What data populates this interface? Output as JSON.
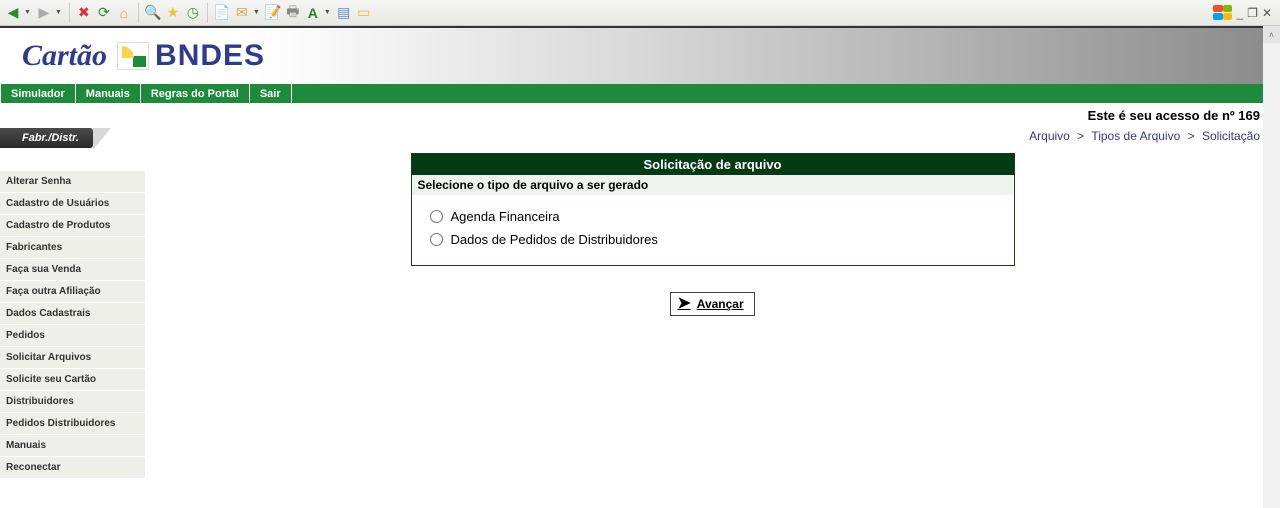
{
  "toolbar": {
    "icons": [
      "back",
      "forward",
      "stop",
      "refresh",
      "home",
      "search",
      "favorites",
      "history",
      "copy",
      "mail",
      "save",
      "print",
      "font-size",
      "edit",
      "note"
    ]
  },
  "window": {
    "minimize": "_",
    "restore": "❐",
    "close": "✕"
  },
  "brand": {
    "cartao": "Cartão",
    "bndes": "BNDES"
  },
  "menu": [
    "Simulador",
    "Manuais",
    "Regras do Portal",
    "Sair"
  ],
  "access_prefix": "Este é seu acesso de nº ",
  "access_no": "169",
  "sidebar": {
    "header": "Fabr./Distr.",
    "items": [
      "Alterar Senha",
      "Cadastro de Usuários",
      "Cadastro de Produtos",
      "Fabricantes",
      "Faça sua Venda",
      "Faça outra Afiliação",
      "Dados Cadastrais",
      "Pedidos",
      "Solicitar Arquivos",
      "Solicite seu Cartão",
      "Distribuidores",
      "Pedidos Distribuidores",
      "Manuais",
      "Reconectar"
    ]
  },
  "breadcrumb": [
    "Arquivo",
    "Tipos de Arquivo",
    "Solicitação"
  ],
  "panel": {
    "title": "Solicitação de arquivo",
    "subtitle": "Selecione o tipo de arquivo a ser gerado",
    "options": [
      "Agenda Financeira",
      "Dados de Pedidos de Distribuidores"
    ]
  },
  "advance_label": "Avançar"
}
